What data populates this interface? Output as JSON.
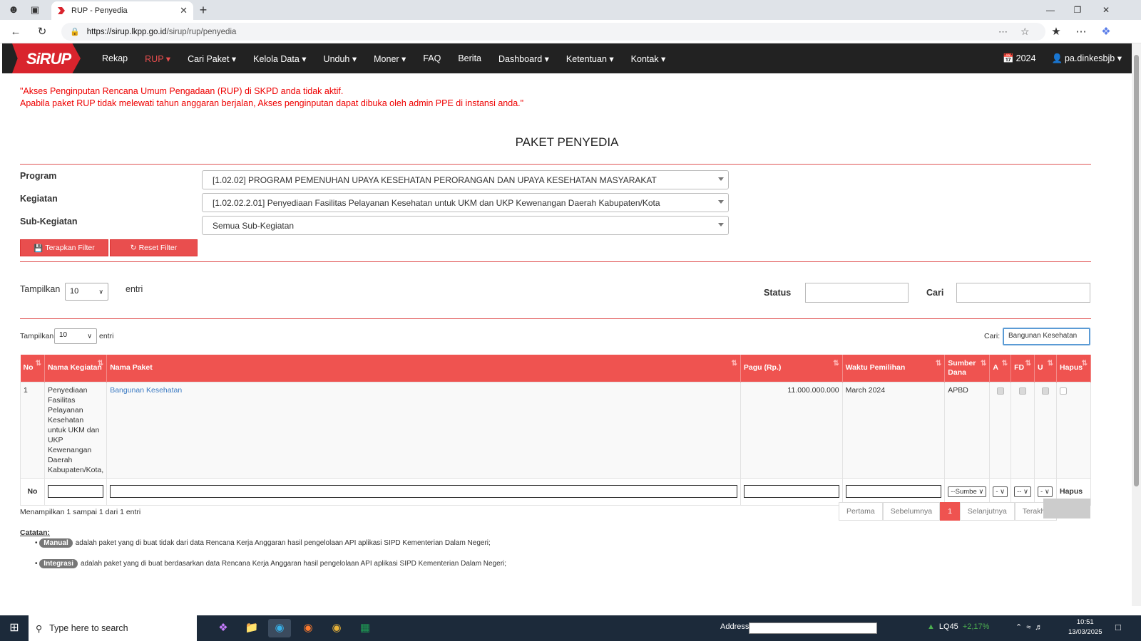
{
  "browser": {
    "tab_title": "RUP - Penyedia",
    "new_tab_icon": "+",
    "url_domain": "https://sirup.lkpp.go.id",
    "url_path": "/sirup/rup/penyedia"
  },
  "site": {
    "logo": "SiRUP",
    "menu": [
      "Rekap",
      "RUP ▾",
      "Cari Paket ▾",
      "Kelola Data ▾",
      "Unduh ▾",
      "Moner ▾",
      "FAQ",
      "Berita",
      "Dashboard ▾",
      "Ketentuan ▾",
      "Kontak ▾"
    ],
    "year": "2024",
    "user": "pa.dinkesbjb ▾"
  },
  "notice": {
    "line1": "\"Akses Penginputan Rencana Umum Pengadaan (RUP) di SKPD anda tidak aktif.",
    "line2": "Apabila paket RUP tidak melewati tahun anggaran berjalan, Akses penginputan dapat dibuka oleh admin PPE di instansi anda.\""
  },
  "page_title": "PAKET PENYEDIA",
  "filters": {
    "program_label": "Program",
    "program_value": "[1.02.02] PROGRAM PEMENUHAN UPAYA KESEHATAN PERORANGAN DAN UPAYA KESEHATAN MASYARAKAT",
    "kegiatan_label": "Kegiatan",
    "kegiatan_value": "[1.02.02.2.01] Penyediaan Fasilitas Pelayanan Kesehatan untuk UKM dan UKP Kewenangan Daerah Kabupaten/Kota",
    "subkegiatan_label": "Sub-Kegiatan",
    "subkegiatan_value": "Semua Sub-Kegiatan",
    "apply_label": "Terapkan Filter",
    "reset_label": "Reset Filter"
  },
  "top_controls": {
    "show_label": "Tampilkan",
    "show_value": "10",
    "entries_label": "entri",
    "status_label": "Status",
    "search_label": "Cari"
  },
  "table_controls": {
    "show_label": "Tampilkan",
    "show_value": "10",
    "entries_label": "entri",
    "search_label": "Cari:",
    "search_value": "Bangunan Kesehatan"
  },
  "table": {
    "headers": [
      "No",
      "Nama Kegiatan",
      "Nama Paket",
      "Pagu (Rp.)",
      "Waktu Pemilihan",
      "Sumber Dana",
      "A",
      "FD",
      "U",
      "Hapus"
    ],
    "rows": [
      {
        "no": "1",
        "kegiatan": "Penyediaan Fasilitas Pelayanan Kesehatan untuk UKM dan UKP Kewenangan Daerah Kabupaten/Kota,",
        "paket": "Bangunan Kesehatan",
        "pagu": "11.000.000.000",
        "waktu": "March 2024",
        "sumber": "APBD"
      }
    ],
    "footer": {
      "no": "No",
      "sumber_select": "--Sumbe",
      "a_select": "-",
      "fd_select": "--",
      "u_select": "-",
      "hapus": "Hapus"
    }
  },
  "info": "Menampilkan 1 sampai 1 dari 1 entri",
  "pagination": [
    "Pertama",
    "Sebelumnya",
    "1",
    "Selanjutnya",
    "Terakhir"
  ],
  "notes": {
    "title": "Catatan:",
    "manual_badge": "Manual",
    "manual_text": "adalah paket yang di buat tidak dari data Rencana Kerja Anggaran hasil pengelolaan API aplikasi SIPD Kementerian Dalam Negeri;",
    "integrasi_badge": "Integrasi",
    "integrasi_text": "adalah paket yang di buat berdasarkan data Rencana Kerja Anggaran hasil pengelolaan API aplikasi SIPD Kementerian Dalam Negeri;"
  },
  "taskbar": {
    "search_placeholder": "Type here to search",
    "address_label": "Address",
    "stock_name": "LQ45",
    "stock_change": "+2,17%",
    "time": "10:51",
    "date": "13/03/2025"
  },
  "colors": {
    "accent": "#ef5350",
    "nav_bg": "#222222",
    "notice": "#ee0000",
    "link": "#3b7ac2"
  }
}
